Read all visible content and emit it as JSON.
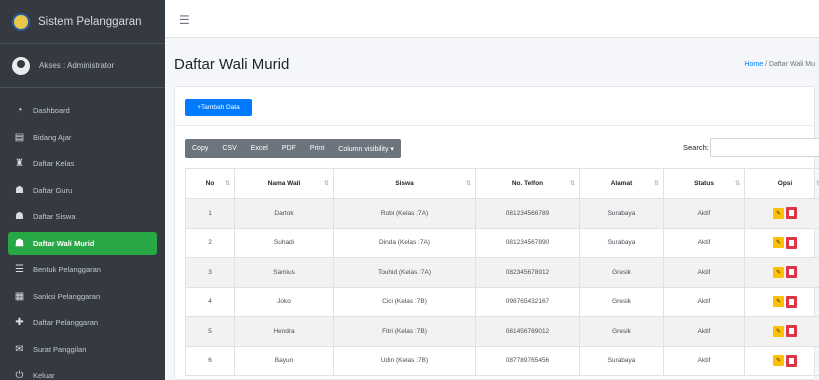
{
  "sidebar": {
    "brand": "Sistem Pelanggaran",
    "user": "Akses : Administrator",
    "items": [
      {
        "label": "Dashboard",
        "icon": "dashboard-icon"
      },
      {
        "label": "Bidang Ajar",
        "icon": "book-icon"
      },
      {
        "label": "Daftar Kelas",
        "icon": "class-icon"
      },
      {
        "label": "Daftar Guru",
        "icon": "teacher-icon"
      },
      {
        "label": "Daftar Siswa",
        "icon": "students-icon"
      },
      {
        "label": "Daftar Wali Murid",
        "icon": "guardian-icon",
        "active": true
      },
      {
        "label": "Bentuk Pelanggaran",
        "icon": "list-icon"
      },
      {
        "label": "Sanksi Pelanggaran",
        "icon": "table-icon"
      },
      {
        "label": "Daftar Pelanggaran",
        "icon": "plus-icon"
      },
      {
        "label": "Surat Panggilan",
        "icon": "letter-icon"
      },
      {
        "label": "Keluar",
        "icon": "power-icon"
      }
    ]
  },
  "topbar": {
    "menu_icon": "hamburger-icon"
  },
  "page": {
    "title": "Daftar Wali Murid",
    "breadcrumb_home": "Home",
    "breadcrumb_sep": "/",
    "breadcrumb_current": "Daftar Wali Mu"
  },
  "toolbar": {
    "add_button": "+Tambah Data",
    "export_buttons": [
      "Copy",
      "CSV",
      "Excel",
      "PDF",
      "Print",
      "Column visibility ▾"
    ],
    "search_label": "Search:"
  },
  "table": {
    "headers": [
      "No",
      "Nama Wali",
      "Siswa",
      "No. Telfon",
      "Alamat",
      "Status",
      "Opsi"
    ],
    "rows": [
      [
        "1",
        "Dartok",
        "Robi (Kelas :7A)",
        "081234566789",
        "Surabaya",
        "Aktif"
      ],
      [
        "2",
        "Suhadi",
        "Dinda (Kelas :7A)",
        "081234567890",
        "Surabaya",
        "Aktif"
      ],
      [
        "3",
        "Samius",
        "Touhid (Kelas :7A)",
        "082345678912",
        "Gresik",
        "Aktif"
      ],
      [
        "4",
        "Joko",
        "Cici (Kelas :7B)",
        "098765432167",
        "Gresik",
        "Aktif"
      ],
      [
        "5",
        "Hendra",
        "Fitri (Kelas :7B)",
        "081456789012",
        "Gresik",
        "Aktif"
      ],
      [
        "6",
        "Bayun",
        "Udin (Kelas :7B)",
        "087789765456",
        "Surabaya",
        "Aktif"
      ]
    ]
  },
  "colors": {
    "sidebar_bg": "#343a40",
    "active_item": "#28a745",
    "primary": "#007bff",
    "edit": "#ffc107",
    "delete": "#dc3545"
  }
}
